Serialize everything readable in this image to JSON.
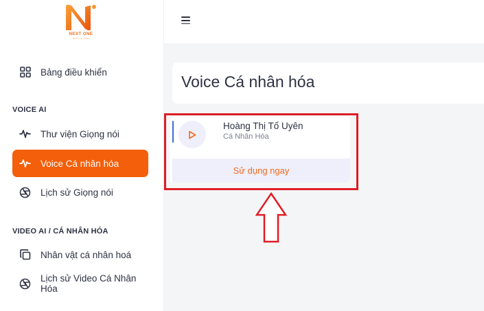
{
  "brand": {
    "name": "NEXT ONE",
    "tagline": "NEXT IS NOW",
    "accent": "#f35f0a"
  },
  "sidebar": {
    "dashboard": {
      "label": "Bảng điều khiển",
      "icon": "grid-icon"
    },
    "voice_ai": {
      "title": "VOICE AI",
      "items": [
        {
          "label": "Thư viện Giọng nói",
          "icon": "waveform-icon"
        },
        {
          "label": "Voice Cá nhân hóa",
          "icon": "waveform-icon",
          "active": true
        },
        {
          "label": "Lịch sử Giọng nói",
          "icon": "aperture-icon"
        }
      ]
    },
    "video_ai": {
      "title": "VIDEO AI / CÁ NHÂN HÓA",
      "items": [
        {
          "label": "Nhân vật cá nhân hoá",
          "icon": "copy-icon"
        },
        {
          "label": "Lịch sử Video Cá Nhân Hóa",
          "icon": "aperture-icon"
        }
      ]
    }
  },
  "topbar": {
    "menu_icon": "hamburger-icon"
  },
  "main": {
    "title": "Voice Cá nhân hóa",
    "voices": [
      {
        "name": "Hoàng Thị Tố Uyên",
        "type": "Cá Nhân Hóa",
        "action_label": "Sử dụng ngay"
      }
    ]
  },
  "annotation": {
    "color": "#e01b24"
  }
}
